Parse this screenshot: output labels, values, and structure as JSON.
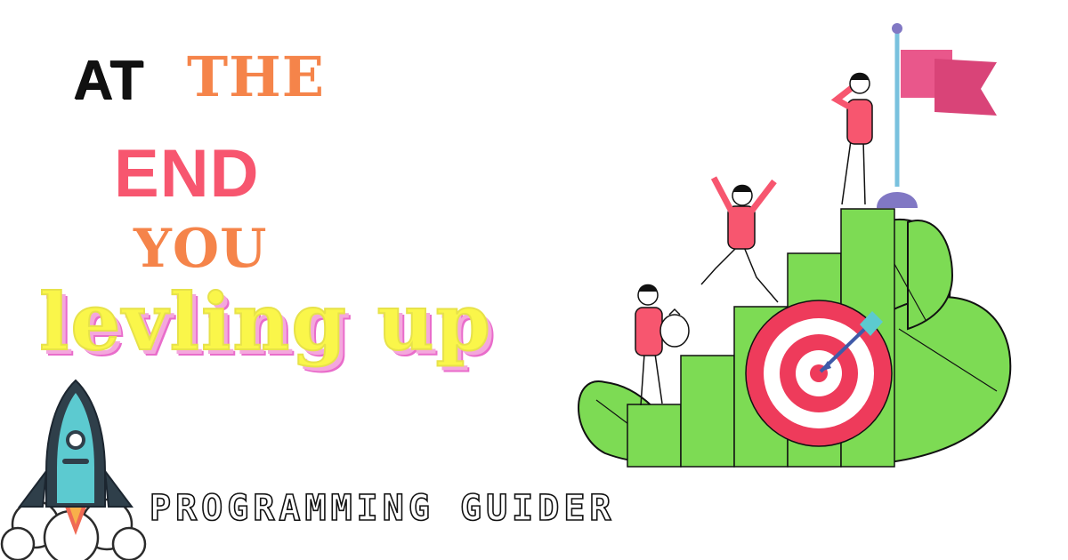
{
  "headline": {
    "line1_word1": "AT",
    "line1_word2": "THE",
    "line2": "END",
    "line3": "YOU",
    "line4": "levling up"
  },
  "brand": {
    "name": "PROGRAMMING GUIDER"
  },
  "colors": {
    "black": "#111111",
    "orange": "#f5844a",
    "coral": "#f7566f",
    "yellow": "#faf64a",
    "pink_shadow": "#e96ccb",
    "green": "#7ddb54",
    "target_red": "#ee3b5b",
    "teal": "#5ccad0",
    "flag_pink": "#e9578b",
    "pole_purple": "#8178c4"
  },
  "icons": {
    "rocket": "rocket-icon",
    "illustration": "growth-stairs-illustration"
  }
}
